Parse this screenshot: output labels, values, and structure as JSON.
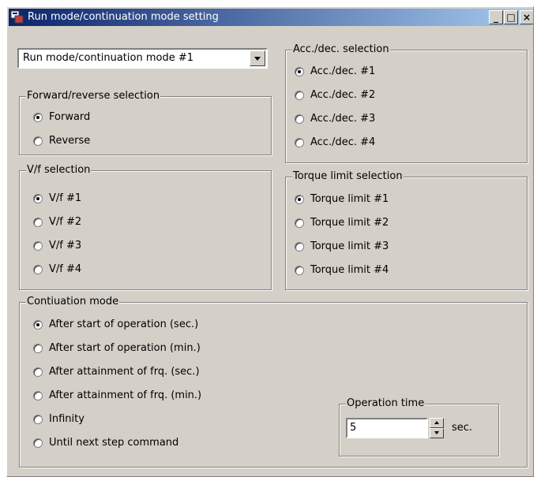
{
  "window": {
    "title": "Run mode/continuation mode setting",
    "buttons": {
      "minimize": "_",
      "maximize": "□",
      "close": "×"
    }
  },
  "mode_select": {
    "value": "Run mode/continuation mode #1"
  },
  "forward_reverse": {
    "title": "Forward/reverse selection",
    "options": [
      "Forward",
      "Reverse"
    ],
    "selected": "Forward"
  },
  "acc_dec": {
    "title": "Acc./dec. selection",
    "options": [
      "Acc./dec. #1",
      "Acc./dec. #2",
      "Acc./dec. #3",
      "Acc./dec. #4"
    ],
    "selected": "Acc./dec. #1"
  },
  "vf": {
    "title": "V/f selection",
    "options": [
      "V/f #1",
      "V/f #2",
      "V/f #3",
      "V/f #4"
    ],
    "selected": "V/f #1"
  },
  "torque": {
    "title": "Torque limit selection",
    "options": [
      "Torque limit #1",
      "Torque limit #2",
      "Torque limit #3",
      "Torque limit #4"
    ],
    "selected": "Torque limit #1"
  },
  "continuation": {
    "title": "Contiuation mode",
    "options": [
      "After start of operation (sec.)",
      "After start of operation (min.)",
      "After attainment of frq. (sec.)",
      "After attainment of frq. (min.)",
      "Infinity",
      "Until next step command"
    ],
    "selected": "After start of operation (sec.)"
  },
  "operation_time": {
    "title": "Operation time",
    "value": "5",
    "unit": "sec."
  }
}
